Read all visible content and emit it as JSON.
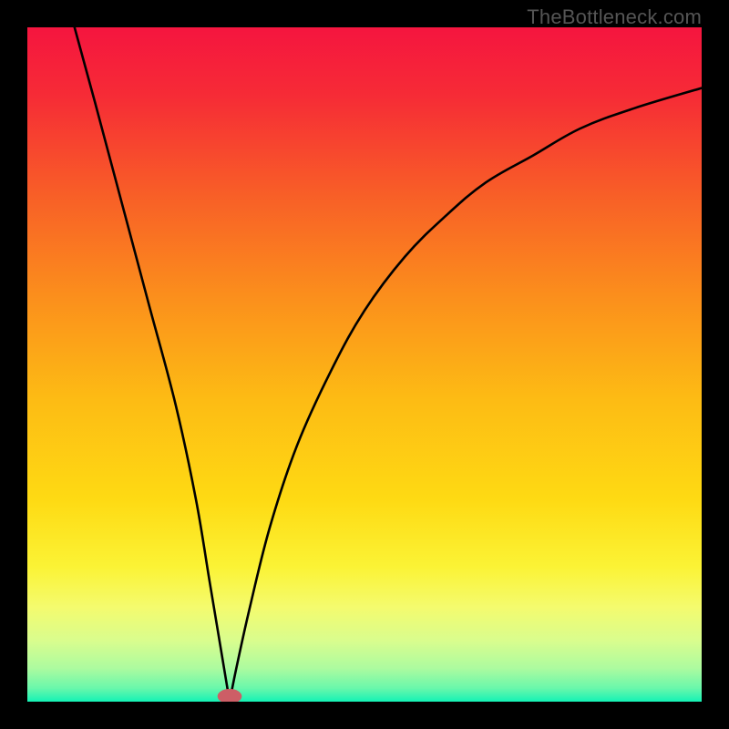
{
  "watermark": "TheBottleneck.com",
  "chart_data": {
    "type": "line",
    "title": "",
    "xlabel": "",
    "ylabel": "",
    "xlim": [
      0,
      100
    ],
    "ylim": [
      0,
      100
    ],
    "grid": false,
    "legend": false,
    "gradient_stops": [
      {
        "offset": 0.0,
        "color": "#f5153f"
      },
      {
        "offset": 0.1,
        "color": "#f62b36"
      },
      {
        "offset": 0.25,
        "color": "#f85f27"
      },
      {
        "offset": 0.4,
        "color": "#fb8f1c"
      },
      {
        "offset": 0.55,
        "color": "#fdbb14"
      },
      {
        "offset": 0.7,
        "color": "#feda13"
      },
      {
        "offset": 0.8,
        "color": "#fbf335"
      },
      {
        "offset": 0.86,
        "color": "#f4fb6e"
      },
      {
        "offset": 0.91,
        "color": "#d9fd8e"
      },
      {
        "offset": 0.95,
        "color": "#adfb9f"
      },
      {
        "offset": 0.98,
        "color": "#6af7ab"
      },
      {
        "offset": 1.0,
        "color": "#14f2b5"
      }
    ],
    "series": [
      {
        "name": "left-branch",
        "x": [
          7,
          10,
          14,
          18,
          22,
          25,
          27,
          28.5,
          29.5,
          30
        ],
        "y": [
          100,
          89,
          74,
          59,
          44,
          30,
          18,
          9,
          3,
          0
        ]
      },
      {
        "name": "right-branch",
        "x": [
          30,
          31,
          33,
          36,
          40,
          45,
          50,
          56,
          62,
          68,
          75,
          82,
          90,
          100
        ],
        "y": [
          0,
          5,
          14,
          26,
          38,
          49,
          58,
          66,
          72,
          77,
          81,
          85,
          88,
          91
        ]
      }
    ],
    "marker": {
      "x": 30,
      "y": 0.8,
      "rx": 1.8,
      "ry": 1.1,
      "color": "#cd5e66"
    }
  }
}
